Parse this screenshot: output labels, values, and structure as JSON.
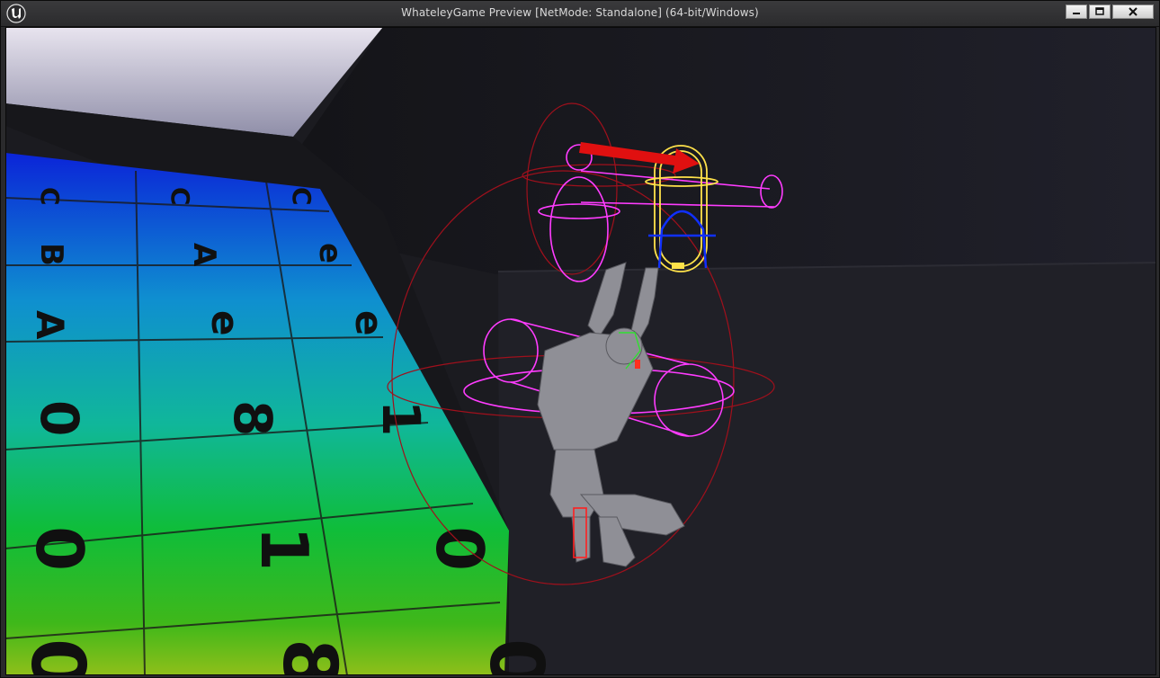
{
  "window": {
    "title": "WhateleyGame Preview [NetMode: Standalone]  (64-bit/Windows)",
    "icons": {
      "logo": "unreal-logo-icon",
      "minimize": "minimize-icon",
      "maximize": "maximize-icon",
      "close": "close-icon"
    }
  },
  "viewport": {
    "grid_rows": [
      {
        "labels": [
          "C",
          "C",
          "C"
        ]
      },
      {
        "labels": [
          "B",
          "A",
          "e"
        ]
      },
      {
        "labels": [
          "A",
          "e",
          "e"
        ]
      },
      {
        "labels": [
          "0",
          "8",
          "1"
        ]
      },
      {
        "labels": [
          "0",
          "1",
          "0"
        ]
      },
      {
        "labels": [
          "0",
          "8",
          "0"
        ]
      }
    ],
    "colors": {
      "sky": "#b9b2c7",
      "wall": "#1f1f24",
      "debug_magenta": "#ff3cff",
      "debug_yellow": "#ffe24a",
      "debug_red": "#c0102a",
      "debug_blue": "#1030ff",
      "arrow_red": "#e01010"
    }
  }
}
